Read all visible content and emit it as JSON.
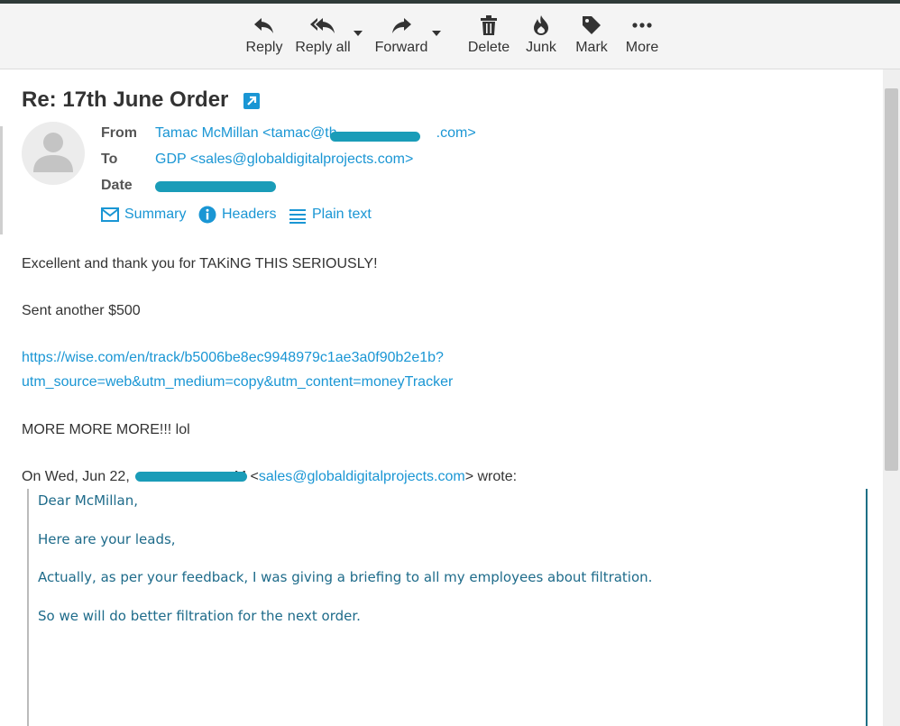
{
  "toolbar": {
    "reply": "Reply",
    "reply_all": "Reply all",
    "forward": "Forward",
    "delete": "Delete",
    "junk": "Junk",
    "mark": "Mark",
    "more": "More"
  },
  "message": {
    "subject": "Re: 17th June Order",
    "headers": {
      "from_label": "From",
      "from_value_prefix": "Tamac McMillan <tamac@th",
      "from_value_suffix": ".com>",
      "to_label": "To",
      "to_value": "GDP <sales@globaldigitalprojects.com>",
      "date_label": "Date"
    },
    "header_links": {
      "summary": "Summary",
      "headers": "Headers",
      "plain_text": "Plain text"
    },
    "body": {
      "line1": "Excellent and thank you for TAKiNG THIS SERIOUSLY!",
      "line2": "Sent another $500",
      "link_line1": "https://wise.com/en/track/b5006be8ec9948979c1ae3a0f90b2e1b?",
      "link_line2": "utm_source=web&utm_medium=copy&utm_content=moneyTracker",
      "line3": "MORE MORE MORE!!! lol",
      "wrote_prefix": "On Wed, Jun 22,",
      "wrote_mid": "M <",
      "wrote_email": "sales@globaldigitalprojects.com",
      "wrote_suffix": "> wrote:"
    },
    "quote": {
      "q1": "Dear McMillan,",
      "q2": "Here are your leads,",
      "q3": "Actually, as per your feedback, I was giving a briefing to all my employees about filtration.",
      "q4": "So we will do better filtration for the next order."
    }
  },
  "colors": {
    "link": "#1a96d4",
    "quote_text": "#1e6b8a",
    "redaction": "#1a9cb8"
  }
}
